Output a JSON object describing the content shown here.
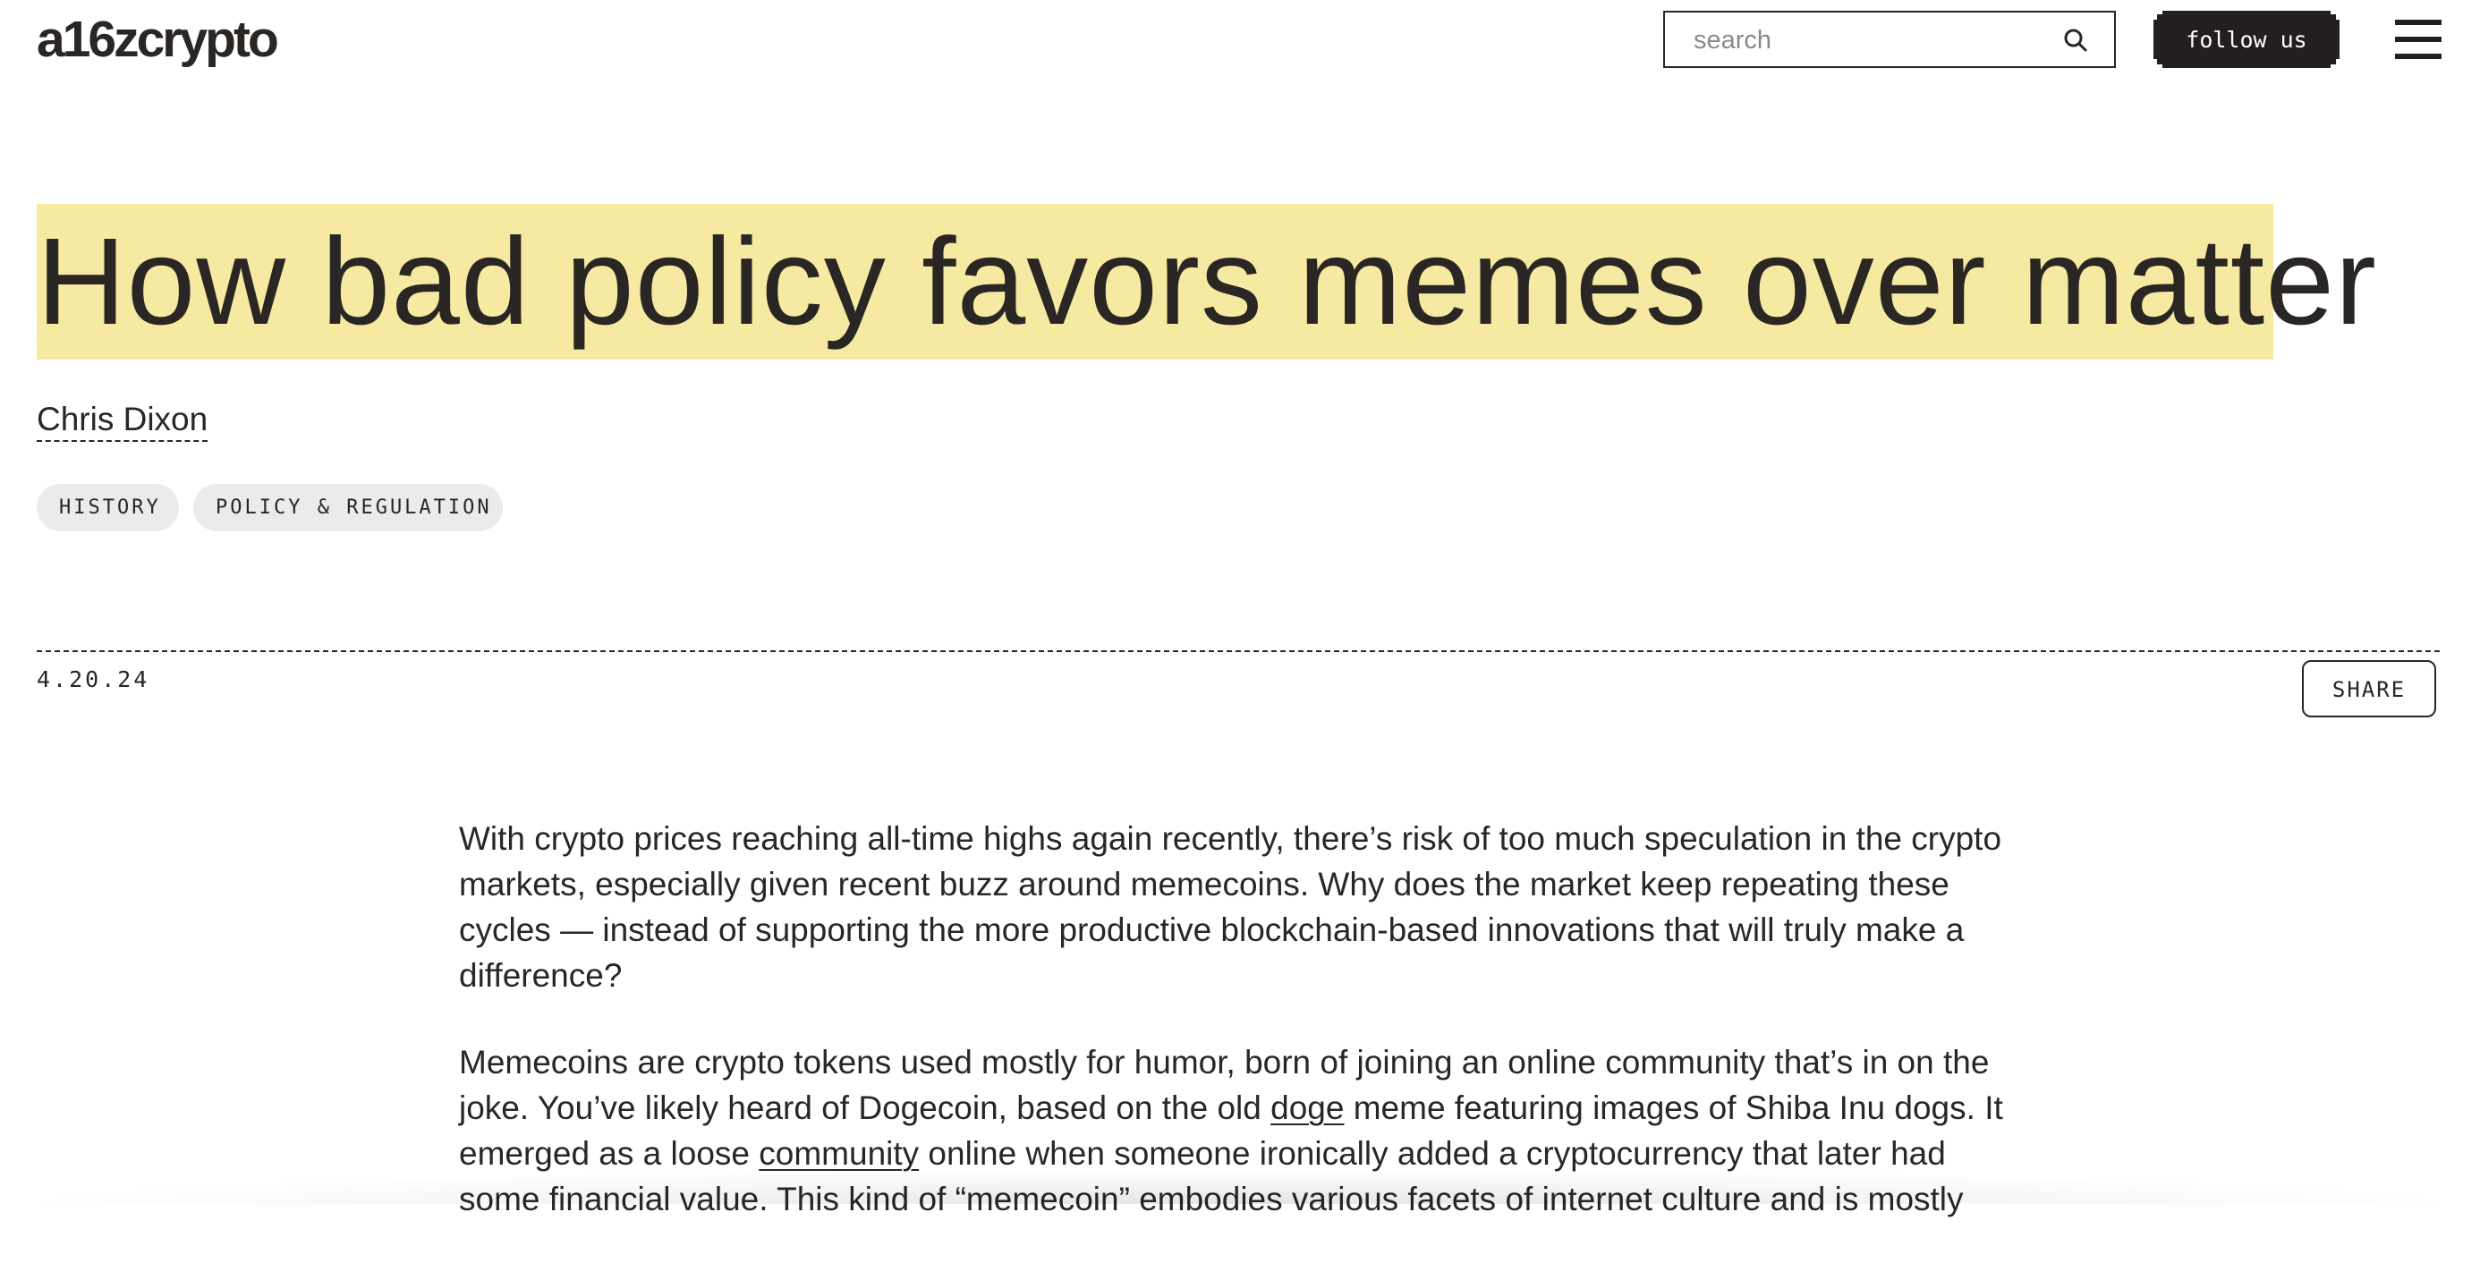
{
  "header": {
    "logo": "a16zcrypto",
    "search": {
      "placeholder": "search",
      "value": "",
      "icon": "search-icon"
    },
    "follow_label": "follow us",
    "menu_icon": "hamburger-menu-icon"
  },
  "article": {
    "title": "How bad policy favors memes over matter",
    "author": "Chris Dixon",
    "tags": [
      "HISTORY",
      "POLICY & REGULATION"
    ],
    "date": "4.20.24",
    "share_label": "SHARE",
    "paragraphs": [
      {
        "text": "With crypto prices reaching all-time highs again recently, there’s risk of too much speculation in the crypto markets, especially given recent buzz around memecoins. Why does the market keep repeating these cycles — instead of supporting the more productive blockchain-based innovations that will truly make a difference?"
      },
      {
        "part1": "Memecoins are crypto tokens used mostly for humor, born of joining an online community that’s in on the joke. You’ve likely heard of Dogecoin, based on the old ",
        "link1": "doge",
        "part2": " meme featuring images of Shiba Inu dogs. It emerged as a loose ",
        "link2": "community",
        "part3": " online when someone ironically added a cryptocurrency that later had some financial value. This kind of “memecoin” embodies various facets of internet culture and is mostly"
      }
    ]
  },
  "colors": {
    "text": "#2a2624",
    "title_highlight": "#f6eaa2",
    "tag_bg": "#ebebeb",
    "button_dark": "#231f20"
  }
}
